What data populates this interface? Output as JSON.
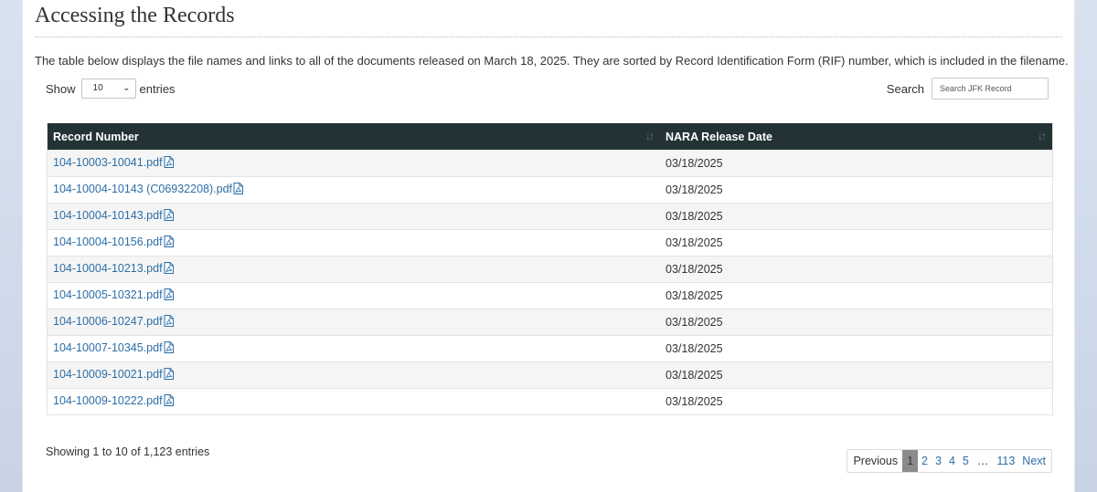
{
  "section": {
    "title": "Accessing the Records",
    "intro": "The table below displays the file names and links to all of the documents released on March 18, 2025.  They are sorted by Record Identification Form (RIF) number, which is included in the filename."
  },
  "length_control": {
    "show_label": "Show",
    "selected": "10",
    "entries_label": "entries"
  },
  "search": {
    "label": "Search",
    "placeholder": "Search JFK Record"
  },
  "table": {
    "columns": [
      "Record Number",
      "NARA Release Date"
    ],
    "rows": [
      {
        "record": "104-10003-10041.pdf",
        "date": "03/18/2025"
      },
      {
        "record": "104-10004-10143 (C06932208).pdf",
        "date": "03/18/2025"
      },
      {
        "record": "104-10004-10143.pdf",
        "date": "03/18/2025"
      },
      {
        "record": "104-10004-10156.pdf",
        "date": "03/18/2025"
      },
      {
        "record": "104-10004-10213.pdf",
        "date": "03/18/2025"
      },
      {
        "record": "104-10005-10321.pdf",
        "date": "03/18/2025"
      },
      {
        "record": "104-10006-10247.pdf",
        "date": "03/18/2025"
      },
      {
        "record": "104-10007-10345.pdf",
        "date": "03/18/2025"
      },
      {
        "record": "104-10009-10021.pdf",
        "date": "03/18/2025"
      },
      {
        "record": "104-10009-10222.pdf",
        "date": "03/18/2025"
      }
    ],
    "icons": {
      "sort": "sort-arrows-icon",
      "file": "pdf-file-icon"
    }
  },
  "info": "Showing 1 to 10 of 1,123 entries",
  "pagination": {
    "previous": "Previous",
    "pages": [
      "1",
      "2",
      "3",
      "4",
      "5"
    ],
    "ellipsis": "…",
    "last": "113",
    "next": "Next",
    "current": "1"
  },
  "colors": {
    "header_bg": "#233235",
    "link": "#2c6ea7",
    "current_page_bg": "#8b8b8b"
  }
}
